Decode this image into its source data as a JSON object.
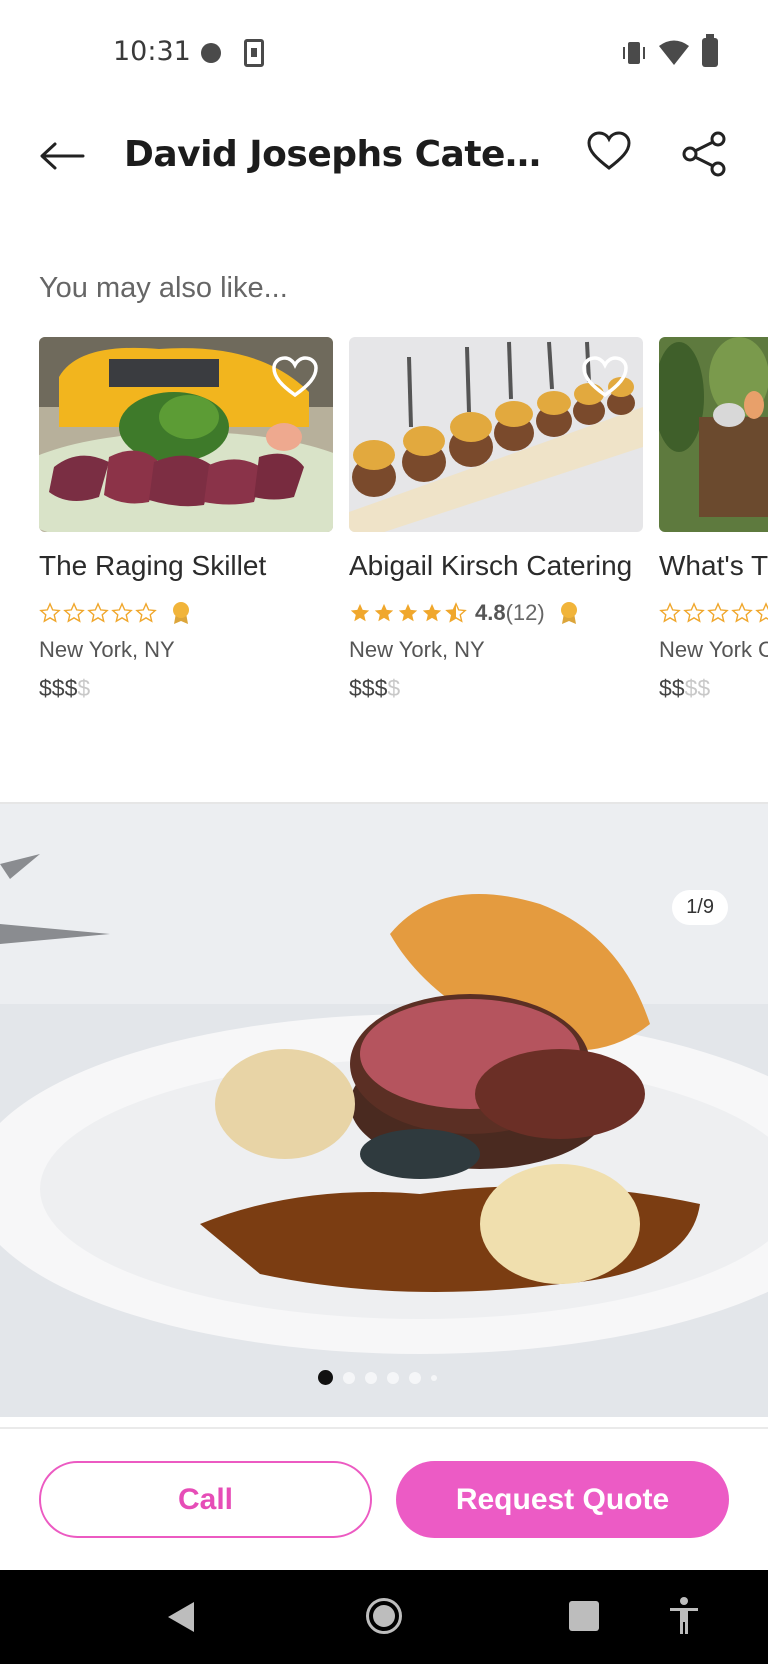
{
  "status_bar": {
    "time": "10:31",
    "icons": [
      "notification-dot-icon",
      "download-icon",
      "vibrate-icon",
      "wifi-icon",
      "battery-icon"
    ]
  },
  "header": {
    "title": "David Josephs Cater...",
    "icons": [
      "back-arrow-icon",
      "heart-outline-icon",
      "share-icon"
    ]
  },
  "recommendations": {
    "heading": "You may also like...",
    "cards": [
      {
        "title": "The Raging Skillet",
        "stars_filled": 0,
        "rating_value": "",
        "rating_count": "",
        "location": "New York, NY",
        "price_active": "$$$",
        "price_inactive": "$"
      },
      {
        "title": "Abigail Kirsch Catering",
        "stars_filled": 4.5,
        "rating_value": "4.8",
        "rating_count": "(12)",
        "location": "New York, NY",
        "price_active": "$$$",
        "price_inactive": "$"
      },
      {
        "title": "What's T",
        "stars_filled": 0,
        "rating_value": "",
        "rating_count": "",
        "location": "New York C",
        "price_active": "$$",
        "price_inactive": "$$"
      }
    ]
  },
  "gallery": {
    "counter": "1/9",
    "current_index": 1,
    "total": 9
  },
  "actions": {
    "call_label": "Call",
    "quote_label": "Request Quote"
  },
  "colors": {
    "accent": "#ec5bc5",
    "star": "#f0a72c",
    "nav_bar": "#000000"
  }
}
